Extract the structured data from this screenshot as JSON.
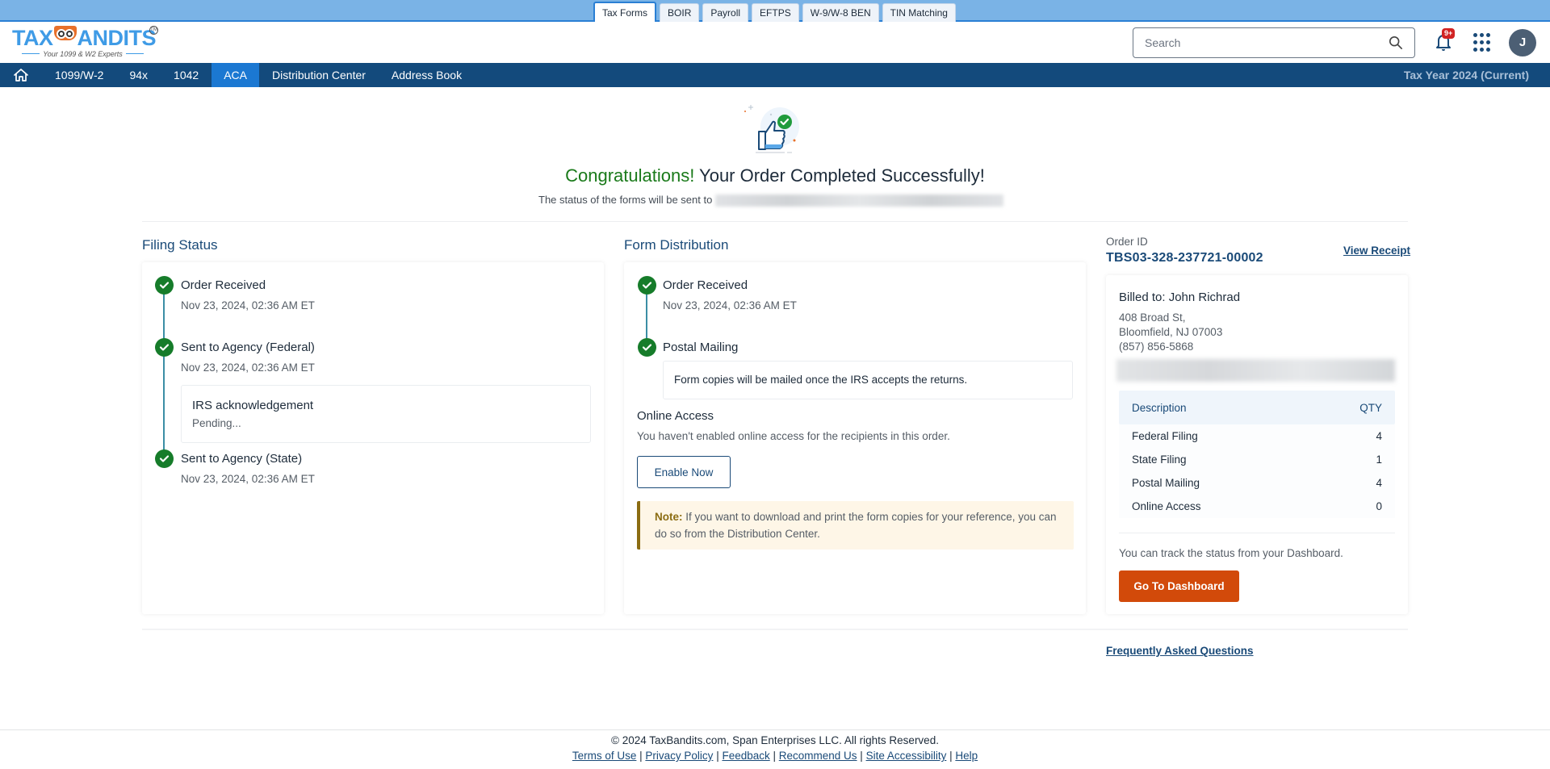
{
  "product_tabs": [
    {
      "label": "Tax Forms",
      "active": true
    },
    {
      "label": "BOIR",
      "active": false
    },
    {
      "label": "Payroll",
      "active": false
    },
    {
      "label": "EFTPS",
      "active": false
    },
    {
      "label": "W-9/W-8 BEN",
      "active": false
    },
    {
      "label": "TIN Matching",
      "active": false
    }
  ],
  "logo": {
    "brand_left": "TAX",
    "brand_right": "ANDITS",
    "tagline": "Your 1099 & W2 Experts",
    "tm": "TM"
  },
  "header": {
    "search_placeholder": "Search",
    "notification_badge": "9+",
    "avatar_initial": "J"
  },
  "nav": {
    "items": [
      {
        "label": "1099/W-2",
        "active": false
      },
      {
        "label": "94x",
        "active": false
      },
      {
        "label": "1042",
        "active": false
      },
      {
        "label": "ACA",
        "active": true
      },
      {
        "label": "Distribution Center",
        "active": false
      },
      {
        "label": "Address Book",
        "active": false
      }
    ],
    "tax_year": "Tax Year 2024 (Current)"
  },
  "hero": {
    "title_highlight": "Congratulations!",
    "title_rest": " Your Order Completed Successfully!",
    "subtitle": "The status of the forms will be sent to"
  },
  "filing_status": {
    "title": "Filing Status",
    "steps": [
      {
        "title": "Order Received",
        "date": "Nov 23, 2024, 02:36 AM ET"
      },
      {
        "title": "Sent to Agency (Federal)",
        "date": "Nov 23, 2024, 02:36 AM ET"
      },
      {
        "title": "Sent to Agency (State)",
        "date": "Nov 23, 2024, 02:36 AM ET"
      }
    ],
    "ack": {
      "title": "IRS acknowledgement",
      "status": "Pending..."
    }
  },
  "form_distribution": {
    "title": "Form Distribution",
    "steps": [
      {
        "title": "Order Received",
        "date": "Nov 23, 2024, 02:36 AM ET"
      },
      {
        "title": "Postal Mailing"
      }
    ],
    "postal_note": "Form copies will be mailed once the IRS accepts the returns.",
    "online_access_title": "Online Access",
    "online_access_text": "You haven't enabled online access for the recipients in this order.",
    "enable_button": "Enable Now",
    "note_label": "Note:",
    "note_text": " If you want to download and print the form copies for your reference, you can do so from the Distribution Center."
  },
  "order": {
    "id_label": "Order ID",
    "id": "TBS03-328-237721-00002",
    "view_receipt": "View Receipt",
    "billed_to": "Billed to: John Richrad",
    "address_line1": "408 Broad St,",
    "address_line2": "Bloomfield, NJ 07003",
    "phone": "(857) 856-5868",
    "table": {
      "headers": [
        "Description",
        "QTY"
      ],
      "rows": [
        {
          "description": "Federal Filing",
          "qty": "4"
        },
        {
          "description": "State Filing",
          "qty": "1"
        },
        {
          "description": "Postal Mailing",
          "qty": "4"
        },
        {
          "description": "Online Access",
          "qty": "0"
        }
      ]
    },
    "track_text": "You can track the status from your Dashboard.",
    "dashboard_button": "Go To Dashboard"
  },
  "faq_link": "Frequently Asked Questions",
  "footer": {
    "copyright": "© 2024 TaxBandits.com, Span Enterprises LLC. All rights Reserved.",
    "links": [
      "Terms of Use",
      "Privacy Policy",
      "Feedback",
      "Recommend Us",
      "Site Accessibility",
      "Help"
    ]
  },
  "colors": {
    "brand_navy": "#134a7c",
    "active_nav": "#1b78d2",
    "success_green": "#167c2a",
    "cta_orange": "#d24a0a",
    "note_border": "#8b6c12"
  }
}
